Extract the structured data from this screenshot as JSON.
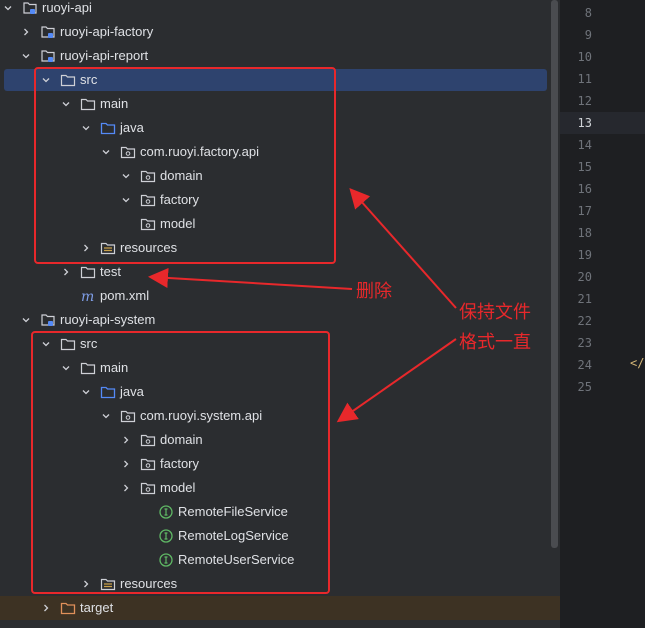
{
  "tree": {
    "rows": [
      {
        "label": "ruoyi-api",
        "chevron": "open",
        "icon": "module-icon"
      },
      {
        "label": "ruoyi-api-factory",
        "chevron": "closed",
        "icon": "module-icon"
      },
      {
        "label": "ruoyi-api-report",
        "chevron": "open",
        "icon": "module-icon"
      },
      {
        "label": "src",
        "chevron": "open",
        "icon": "folder-icon",
        "selected": true
      },
      {
        "label": "main",
        "chevron": "open",
        "icon": "folder-icon"
      },
      {
        "label": "java",
        "chevron": "open",
        "icon": "source-folder-icon"
      },
      {
        "label": "com.ruoyi.factory.api",
        "chevron": "open",
        "icon": "package-icon"
      },
      {
        "label": "domain",
        "chevron": "open",
        "icon": "package-icon"
      },
      {
        "label": "factory",
        "chevron": "open",
        "icon": "package-icon"
      },
      {
        "label": "model",
        "chevron": "none",
        "icon": "package-icon"
      },
      {
        "label": "resources",
        "chevron": "closed",
        "icon": "resources-folder-icon"
      },
      {
        "label": "test",
        "chevron": "closed",
        "icon": "folder-icon"
      },
      {
        "label": "pom.xml",
        "chevron": "none",
        "icon": "maven-icon"
      },
      {
        "label": "ruoyi-api-system",
        "chevron": "open",
        "icon": "module-icon"
      },
      {
        "label": "src",
        "chevron": "open",
        "icon": "folder-icon"
      },
      {
        "label": "main",
        "chevron": "open",
        "icon": "folder-icon"
      },
      {
        "label": "java",
        "chevron": "open",
        "icon": "source-folder-icon"
      },
      {
        "label": "com.ruoyi.system.api",
        "chevron": "open",
        "icon": "package-icon"
      },
      {
        "label": "domain",
        "chevron": "closed",
        "icon": "package-icon"
      },
      {
        "label": "factory",
        "chevron": "closed",
        "icon": "package-icon"
      },
      {
        "label": "model",
        "chevron": "closed",
        "icon": "package-icon"
      },
      {
        "label": "RemoteFileService",
        "chevron": "none",
        "icon": "interface-icon"
      },
      {
        "label": "RemoteLogService",
        "chevron": "none",
        "icon": "interface-icon"
      },
      {
        "label": "RemoteUserService",
        "chevron": "none",
        "icon": "interface-icon"
      },
      {
        "label": "resources",
        "chevron": "closed",
        "icon": "resources-folder-icon"
      },
      {
        "label": "target",
        "chevron": "closed",
        "icon": "excluded-folder-icon"
      }
    ]
  },
  "editor": {
    "line_numbers": [
      "8",
      "9",
      "10",
      "11",
      "12",
      "13",
      "14",
      "15",
      "16",
      "17",
      "18",
      "19",
      "20",
      "21",
      "22",
      "23",
      "24",
      "25"
    ],
    "current_line": "13",
    "code_fragment": "</"
  },
  "annotations": {
    "delete_label": "删除",
    "keep_label_line1": "保持文件",
    "keep_label_line2": "格式一直"
  },
  "colors": {
    "background": "#2b2d30",
    "selection": "#2e436e",
    "annotation_red": "#e8282b",
    "interface_green": "#5fb865",
    "source_folder_blue": "#548af7"
  }
}
